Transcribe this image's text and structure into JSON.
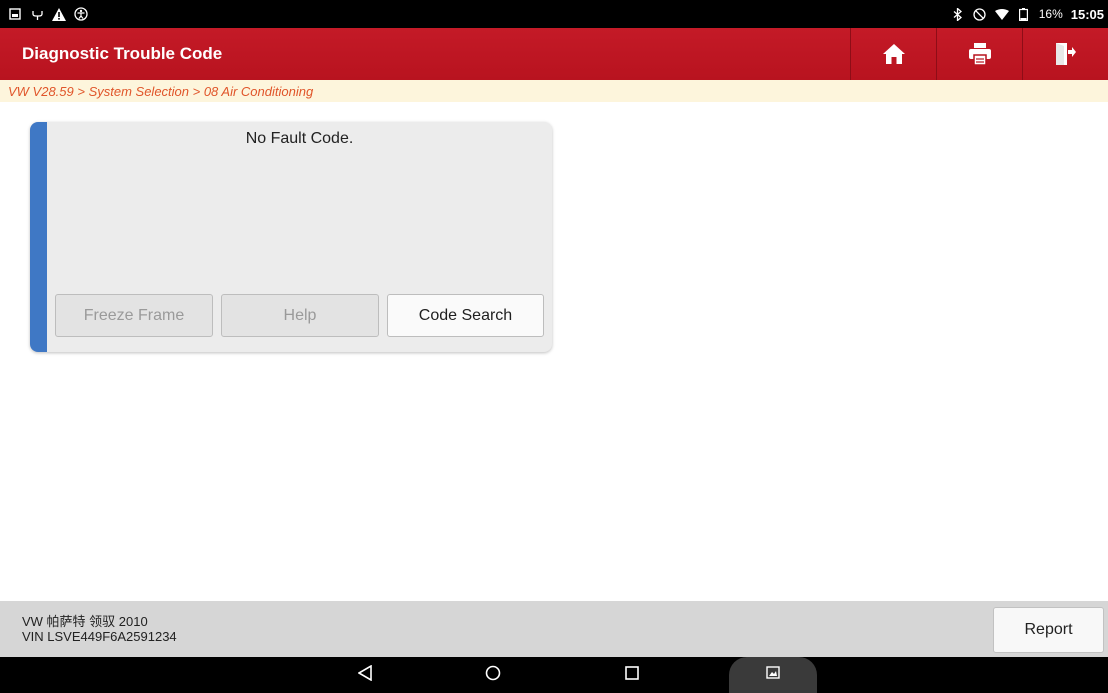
{
  "status_bar": {
    "left_icons": [
      "gallery-icon",
      "usb-icon",
      "warning-icon",
      "accessibility-icon"
    ],
    "right_icons": [
      "bluetooth-icon",
      "do-not-disturb-icon",
      "wifi-icon",
      "battery-icon"
    ],
    "battery_percent": "16%",
    "time": "15:05"
  },
  "header": {
    "title": "Diagnostic Trouble Code",
    "buttons": [
      "home-icon",
      "print-icon",
      "exit-icon"
    ],
    "color": "#c41a27"
  },
  "breadcrumb": "VW V28.59 > System Selection > 08 Air Conditioning",
  "fault_card": {
    "message": "No Fault Code.",
    "accent_color": "#3f78c5",
    "buttons": {
      "freeze_frame": "Freeze Frame",
      "help": "Help",
      "code_search": "Code Search"
    }
  },
  "footer": {
    "vehicle": "VW 帕萨特 领驭 2010",
    "vin": "VIN LSVE449F6A2591234",
    "report": "Report"
  },
  "nav_bar": {
    "buttons": [
      "back-icon",
      "home-circle-icon",
      "recents-icon",
      "screenshot-icon"
    ]
  }
}
